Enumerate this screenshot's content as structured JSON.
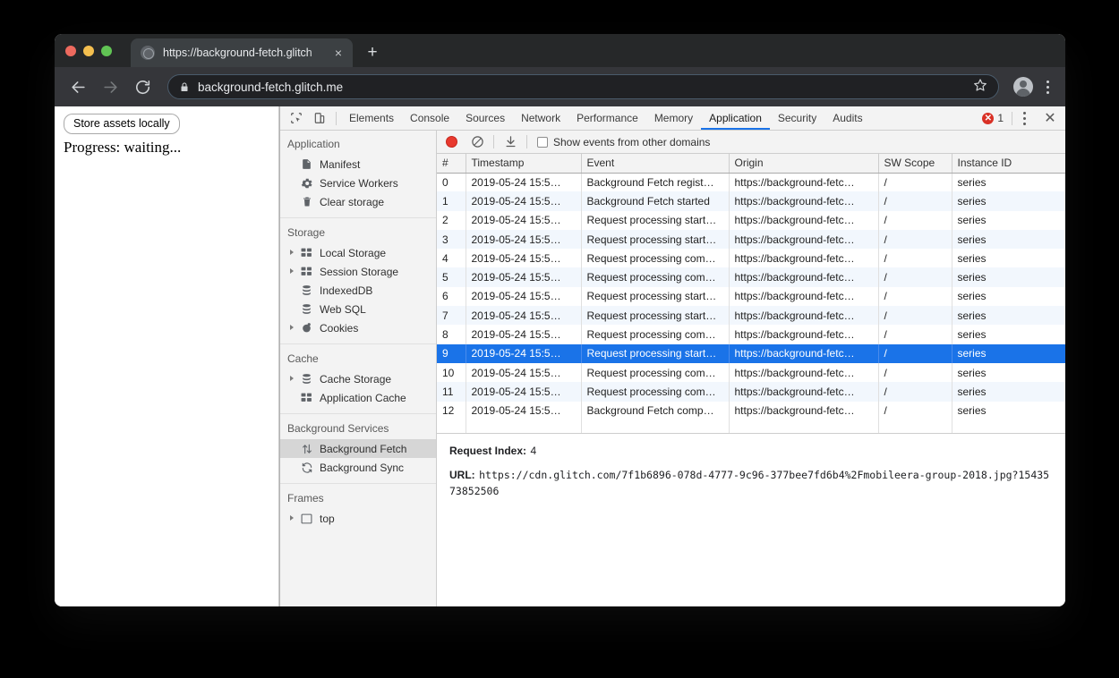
{
  "browser": {
    "tab": {
      "title": "https://background-fetch.glitch",
      "favicon": "globe-icon",
      "close": "×"
    },
    "new_tab": "+",
    "nav": {
      "back": "←",
      "forward": "→",
      "reload": "⟳"
    },
    "omnibox": {
      "url": "background-fetch.glitch.me",
      "lock": "lock-icon"
    },
    "star": "☆"
  },
  "page": {
    "store_button": "Store assets locally",
    "progress": "Progress: waiting..."
  },
  "devtools": {
    "tabs": [
      {
        "label": "Elements",
        "active": false
      },
      {
        "label": "Console",
        "active": false
      },
      {
        "label": "Sources",
        "active": false
      },
      {
        "label": "Network",
        "active": false
      },
      {
        "label": "Performance",
        "active": false
      },
      {
        "label": "Memory",
        "active": false
      },
      {
        "label": "Application",
        "active": true
      },
      {
        "label": "Security",
        "active": false
      },
      {
        "label": "Audits",
        "active": false
      }
    ],
    "error_count": "1",
    "error_glyph": "✕",
    "close": "✕",
    "sidebar": [
      {
        "header": "Application",
        "items": [
          {
            "label": "Manifest",
            "icon": "document-icon",
            "arrow": false,
            "selected": false
          },
          {
            "label": "Service Workers",
            "icon": "gear-icon",
            "arrow": false,
            "selected": false
          },
          {
            "label": "Clear storage",
            "icon": "trash-icon",
            "arrow": false,
            "selected": false
          }
        ]
      },
      {
        "header": "Storage",
        "items": [
          {
            "label": "Local Storage",
            "icon": "table-icon",
            "arrow": true,
            "selected": false
          },
          {
            "label": "Session Storage",
            "icon": "table-icon",
            "arrow": true,
            "selected": false
          },
          {
            "label": "IndexedDB",
            "icon": "database-icon",
            "arrow": false,
            "selected": false
          },
          {
            "label": "Web SQL",
            "icon": "database-icon",
            "arrow": false,
            "selected": false
          },
          {
            "label": "Cookies",
            "icon": "cookie-icon",
            "arrow": true,
            "selected": false
          }
        ]
      },
      {
        "header": "Cache",
        "items": [
          {
            "label": "Cache Storage",
            "icon": "database-icon",
            "arrow": true,
            "selected": false
          },
          {
            "label": "Application Cache",
            "icon": "table-icon",
            "arrow": false,
            "selected": false
          }
        ]
      },
      {
        "header": "Background Services",
        "items": [
          {
            "label": "Background Fetch",
            "icon": "updown-arrows-icon",
            "arrow": false,
            "selected": true
          },
          {
            "label": "Background Sync",
            "icon": "refresh-icon",
            "arrow": false,
            "selected": false
          }
        ]
      },
      {
        "header": "Frames",
        "items": [
          {
            "label": "top",
            "icon": "frame-icon",
            "arrow": true,
            "selected": false
          }
        ]
      }
    ],
    "panel_toolbar": {
      "record": "record-button",
      "clear": "clear-button",
      "download": "download-button",
      "checkbox_label": "Show events from other domains",
      "checkbox_checked": false
    },
    "table": {
      "columns": [
        "#",
        "Timestamp",
        "Event",
        "Origin",
        "SW Scope",
        "Instance ID"
      ],
      "rows": [
        {
          "num": "0",
          "timestamp": "2019-05-24 15:5…",
          "event": "Background Fetch regist…",
          "origin": "https://background-fetc…",
          "scope": "/",
          "instance": "series",
          "selected": false
        },
        {
          "num": "1",
          "timestamp": "2019-05-24 15:5…",
          "event": "Background Fetch started",
          "origin": "https://background-fetc…",
          "scope": "/",
          "instance": "series",
          "selected": false
        },
        {
          "num": "2",
          "timestamp": "2019-05-24 15:5…",
          "event": "Request processing start…",
          "origin": "https://background-fetc…",
          "scope": "/",
          "instance": "series",
          "selected": false
        },
        {
          "num": "3",
          "timestamp": "2019-05-24 15:5…",
          "event": "Request processing start…",
          "origin": "https://background-fetc…",
          "scope": "/",
          "instance": "series",
          "selected": false
        },
        {
          "num": "4",
          "timestamp": "2019-05-24 15:5…",
          "event": "Request processing com…",
          "origin": "https://background-fetc…",
          "scope": "/",
          "instance": "series",
          "selected": false
        },
        {
          "num": "5",
          "timestamp": "2019-05-24 15:5…",
          "event": "Request processing com…",
          "origin": "https://background-fetc…",
          "scope": "/",
          "instance": "series",
          "selected": false
        },
        {
          "num": "6",
          "timestamp": "2019-05-24 15:5…",
          "event": "Request processing start…",
          "origin": "https://background-fetc…",
          "scope": "/",
          "instance": "series",
          "selected": false
        },
        {
          "num": "7",
          "timestamp": "2019-05-24 15:5…",
          "event": "Request processing start…",
          "origin": "https://background-fetc…",
          "scope": "/",
          "instance": "series",
          "selected": false
        },
        {
          "num": "8",
          "timestamp": "2019-05-24 15:5…",
          "event": "Request processing com…",
          "origin": "https://background-fetc…",
          "scope": "/",
          "instance": "series",
          "selected": false
        },
        {
          "num": "9",
          "timestamp": "2019-05-24 15:5…",
          "event": "Request processing start…",
          "origin": "https://background-fetc…",
          "scope": "/",
          "instance": "series",
          "selected": true
        },
        {
          "num": "10",
          "timestamp": "2019-05-24 15:5…",
          "event": "Request processing com…",
          "origin": "https://background-fetc…",
          "scope": "/",
          "instance": "series",
          "selected": false
        },
        {
          "num": "11",
          "timestamp": "2019-05-24 15:5…",
          "event": "Request processing com…",
          "origin": "https://background-fetc…",
          "scope": "/",
          "instance": "series",
          "selected": false
        },
        {
          "num": "12",
          "timestamp": "2019-05-24 15:5…",
          "event": "Background Fetch comp…",
          "origin": "https://background-fetc…",
          "scope": "/",
          "instance": "series",
          "selected": false
        }
      ]
    },
    "detail": {
      "request_index_key": "Request Index:",
      "request_index_value": "4",
      "url_key": "URL:",
      "url_value": "https://cdn.glitch.com/7f1b6896-078d-4777-9c96-377bee7fd6b4%2Fmobileera-group-2018.jpg?1543573852506"
    }
  },
  "colors": {
    "accent": "#1a73e8",
    "record": "#e8392e",
    "error": "#d93025",
    "chrome_toolbar": "#35363a",
    "chrome_tabstrip": "#262829"
  }
}
